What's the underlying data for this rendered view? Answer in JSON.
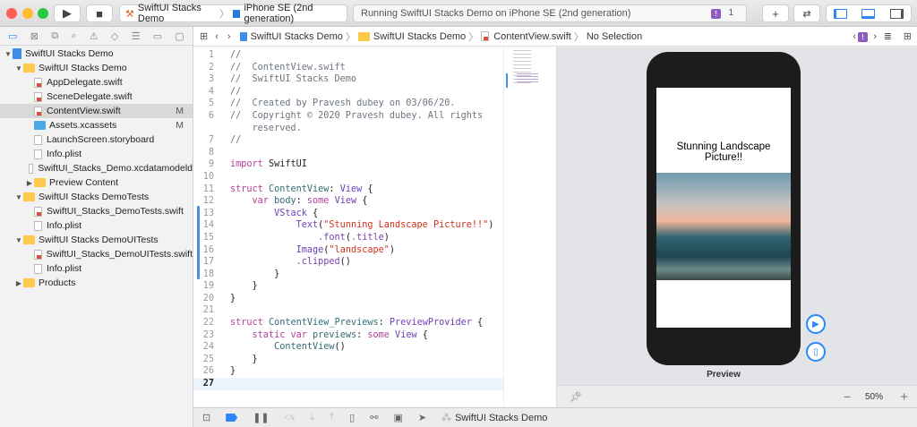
{
  "toolbar": {
    "scheme": "SwiftUI Stacks Demo",
    "device": "iPhone SE (2nd generation)",
    "status": "Running SwiftUI Stacks Demo on iPhone SE (2nd generation)",
    "issue_count": "1",
    "issue_badge": "!"
  },
  "navigator": {
    "items": [
      {
        "label": "SwiftUI Stacks Demo",
        "kind": "project",
        "indent": 0,
        "open": true
      },
      {
        "label": "SwiftUI Stacks Demo",
        "kind": "folder",
        "indent": 1,
        "open": true
      },
      {
        "label": "AppDelegate.swift",
        "kind": "swift",
        "indent": 2
      },
      {
        "label": "SceneDelegate.swift",
        "kind": "swift",
        "indent": 2
      },
      {
        "label": "ContentView.swift",
        "kind": "swift",
        "indent": 2,
        "selected": true,
        "status": "M"
      },
      {
        "label": "Assets.xcassets",
        "kind": "assets",
        "indent": 2,
        "status": "M"
      },
      {
        "label": "LaunchScreen.storyboard",
        "kind": "file",
        "indent": 2
      },
      {
        "label": "Info.plist",
        "kind": "file",
        "indent": 2
      },
      {
        "label": "SwiftUI_Stacks_Demo.xcdatamodeld",
        "kind": "file",
        "indent": 2
      },
      {
        "label": "Preview Content",
        "kind": "folder",
        "indent": 2,
        "open": false
      },
      {
        "label": "SwiftUI Stacks DemoTests",
        "kind": "folder",
        "indent": 1,
        "open": true
      },
      {
        "label": "SwiftUI_Stacks_DemoTests.swift",
        "kind": "swift",
        "indent": 2
      },
      {
        "label": "Info.plist",
        "kind": "file",
        "indent": 2
      },
      {
        "label": "SwiftUI Stacks DemoUITests",
        "kind": "folder",
        "indent": 1,
        "open": true
      },
      {
        "label": "SwiftUI_Stacks_DemoUITests.swift",
        "kind": "swift",
        "indent": 2
      },
      {
        "label": "Info.plist",
        "kind": "file",
        "indent": 2
      },
      {
        "label": "Products",
        "kind": "folder",
        "indent": 1,
        "open": false
      }
    ]
  },
  "jumpbar": {
    "project": "SwiftUI Stacks Demo",
    "group": "SwiftUI Stacks Demo",
    "file": "ContentView.swift",
    "symbol": "No Selection"
  },
  "code": [
    {
      "n": "1",
      "t": [
        [
          "//",
          "com"
        ]
      ]
    },
    {
      "n": "2",
      "t": [
        [
          "//  ContentView.swift",
          "com"
        ]
      ]
    },
    {
      "n": "3",
      "t": [
        [
          "//  SwiftUI Stacks Demo",
          "com"
        ]
      ]
    },
    {
      "n": "4",
      "t": [
        [
          "//",
          "com"
        ]
      ]
    },
    {
      "n": "5",
      "t": [
        [
          "//  Created by Pravesh dubey on 03/06/20.",
          "com"
        ]
      ]
    },
    {
      "n": "6",
      "t": [
        [
          "//  Copyright © 2020 Pravesh dubey. All rights",
          "com"
        ]
      ]
    },
    {
      "n": "",
      "t": [
        [
          "    reserved.",
          "com"
        ]
      ]
    },
    {
      "n": "7",
      "t": [
        [
          "//",
          "com"
        ]
      ]
    },
    {
      "n": "8",
      "t": []
    },
    {
      "n": "9",
      "t": [
        [
          "import",
          "kw"
        ],
        [
          " SwiftUI",
          "pl"
        ]
      ]
    },
    {
      "n": "10",
      "t": []
    },
    {
      "n": "11",
      "t": [
        [
          "struct",
          "kw"
        ],
        [
          " ContentView",
          "id"
        ],
        [
          ": ",
          "pl"
        ],
        [
          "View",
          "typ"
        ],
        [
          " {",
          "pl"
        ]
      ]
    },
    {
      "n": "12",
      "t": [
        [
          "    var",
          "kw"
        ],
        [
          " body",
          "id"
        ],
        [
          ": ",
          "pl"
        ],
        [
          "some",
          "kw"
        ],
        [
          " View",
          "typ"
        ],
        [
          " {",
          "pl"
        ]
      ]
    },
    {
      "n": "13",
      "t": [
        [
          "        VStack",
          "typ"
        ],
        [
          " {",
          "pl"
        ]
      ]
    },
    {
      "n": "14",
      "t": [
        [
          "            Text",
          "typ"
        ],
        [
          "(",
          "pl"
        ],
        [
          "\"Stunning Landscape Picture!!\"",
          "str"
        ],
        [
          ")",
          "pl"
        ]
      ]
    },
    {
      "n": "15",
      "t": [
        [
          "                .font",
          "fn"
        ],
        [
          "(",
          "pl"
        ],
        [
          ".title",
          "fn"
        ],
        [
          ")",
          "pl"
        ]
      ]
    },
    {
      "n": "16",
      "t": [
        [
          "            Image",
          "typ"
        ],
        [
          "(",
          "pl"
        ],
        [
          "\"landscape\"",
          "str"
        ],
        [
          ")",
          "pl"
        ]
      ]
    },
    {
      "n": "17",
      "t": [
        [
          "            .clipped",
          "fn"
        ],
        [
          "()",
          "pl"
        ]
      ]
    },
    {
      "n": "18",
      "t": [
        [
          "        }",
          "pl"
        ]
      ]
    },
    {
      "n": "19",
      "t": [
        [
          "    }",
          "pl"
        ]
      ]
    },
    {
      "n": "20",
      "t": [
        [
          "}",
          "pl"
        ]
      ]
    },
    {
      "n": "21",
      "t": []
    },
    {
      "n": "22",
      "t": [
        [
          "struct",
          "kw"
        ],
        [
          " ContentView_Previews",
          "id"
        ],
        [
          ": ",
          "pl"
        ],
        [
          "PreviewProvider",
          "typ"
        ],
        [
          " {",
          "pl"
        ]
      ]
    },
    {
      "n": "23",
      "t": [
        [
          "    static",
          "kw"
        ],
        [
          " var",
          "kw"
        ],
        [
          " previews",
          "id"
        ],
        [
          ": ",
          "pl"
        ],
        [
          "some",
          "kw"
        ],
        [
          " View",
          "typ"
        ],
        [
          " {",
          "pl"
        ]
      ]
    },
    {
      "n": "24",
      "t": [
        [
          "        ContentView",
          "id"
        ],
        [
          "()",
          "pl"
        ]
      ]
    },
    {
      "n": "25",
      "t": [
        [
          "    }",
          "pl"
        ]
      ]
    },
    {
      "n": "26",
      "t": [
        [
          "}",
          "pl"
        ]
      ]
    },
    {
      "n": "27",
      "t": [],
      "current": true
    }
  ],
  "preview": {
    "text": "Stunning Landscape Picture!!",
    "label": "Preview",
    "zoom": "50%"
  },
  "debug": {
    "target": "SwiftUI Stacks Demo"
  },
  "colors": {
    "accent": "#2b87f5",
    "issue": "#8e5cc0"
  }
}
